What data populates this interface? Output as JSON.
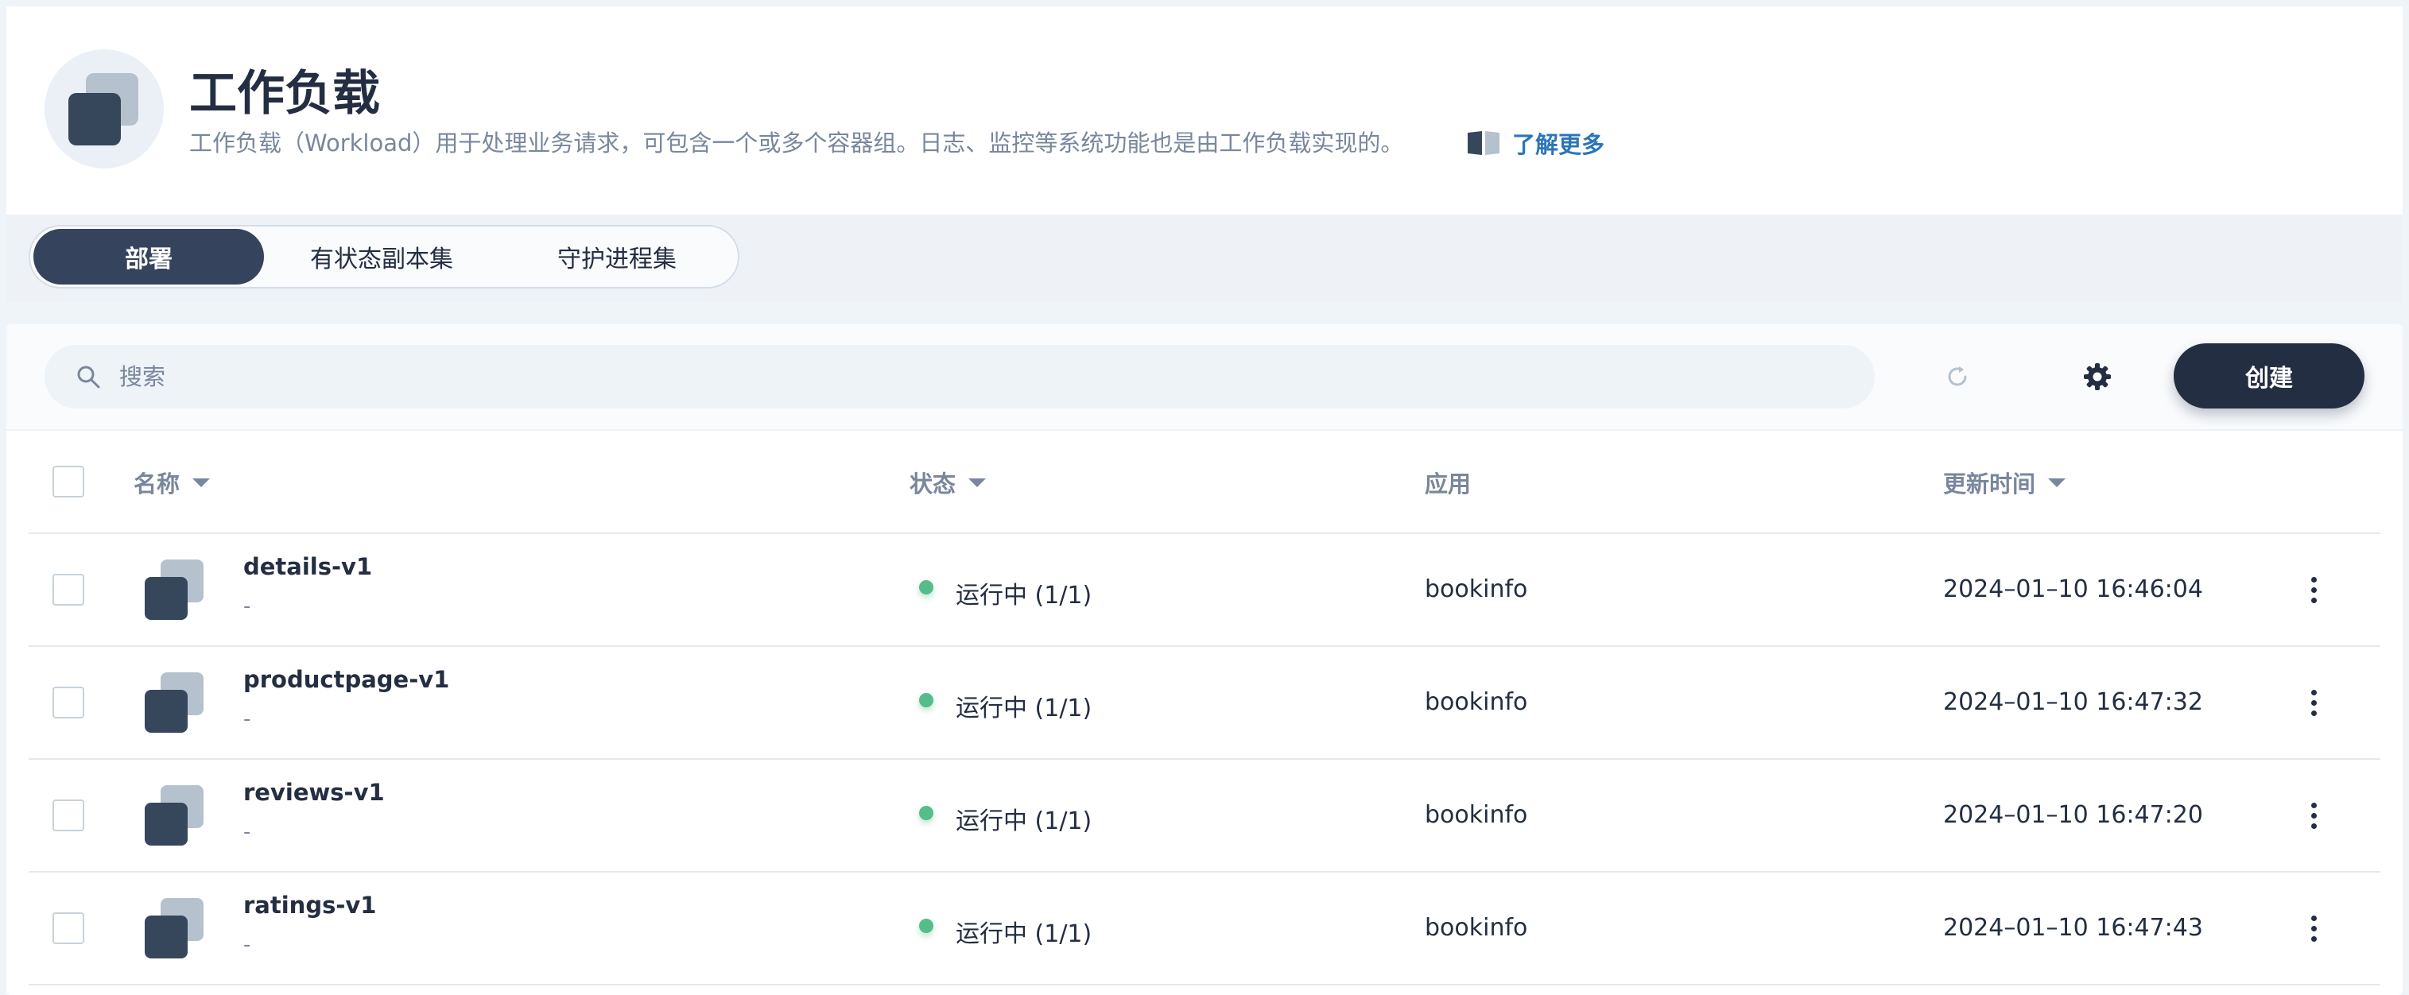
{
  "header": {
    "title": "工作负载",
    "description": "工作负载（Workload）用于处理业务请求，可包含一个或多个容器组。日志、监控等系统功能也是由工作负载实现的。",
    "learn_more": "了解更多"
  },
  "tabs": [
    {
      "label": "部署",
      "active": true
    },
    {
      "label": "有状态副本集",
      "active": false
    },
    {
      "label": "守护进程集",
      "active": false
    }
  ],
  "toolbar": {
    "search_placeholder": "搜索",
    "create_label": "创建"
  },
  "table": {
    "columns": {
      "name": "名称",
      "status": "状态",
      "app": "应用",
      "updated": "更新时间"
    },
    "rows": [
      {
        "name": "details-v1",
        "desc": "-",
        "status": "运行中 (1/1)",
        "app": "bookinfo",
        "updated": "2024–01–10 16:46:04"
      },
      {
        "name": "productpage-v1",
        "desc": "-",
        "status": "运行中 (1/1)",
        "app": "bookinfo",
        "updated": "2024–01–10 16:47:32"
      },
      {
        "name": "reviews-v1",
        "desc": "-",
        "status": "运行中 (1/1)",
        "app": "bookinfo",
        "updated": "2024–01–10 16:47:20"
      },
      {
        "name": "ratings-v1",
        "desc": "-",
        "status": "运行中 (1/1)",
        "app": "bookinfo",
        "updated": "2024–01–10 16:47:43"
      }
    ]
  },
  "colors": {
    "primary_dark": "#242e42",
    "status_running": "#55bc8a",
    "muted_text": "#79879c",
    "link": "#2b75b8"
  },
  "icons": [
    "workload-icon",
    "book-icon",
    "search-icon",
    "refresh-icon",
    "gear-icon",
    "more-vertical-icon"
  ]
}
